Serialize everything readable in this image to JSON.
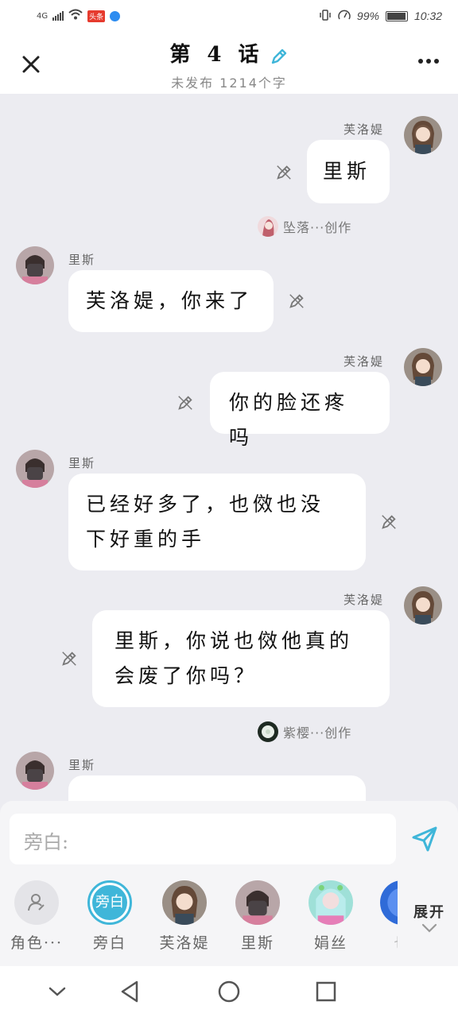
{
  "status_bar": {
    "network": "4G",
    "news_badge": "头条",
    "battery_text": "99%",
    "time": "10:32"
  },
  "header": {
    "title": "第 4 话",
    "subtitle": "未发布 1214个字"
  },
  "messages": [
    {
      "side": "right",
      "speaker": "芙洛媞",
      "text": "里斯"
    },
    {
      "type": "creator",
      "text": "坠落···创作"
    },
    {
      "side": "left",
      "speaker": "里斯",
      "text": "芙洛媞，你来了"
    },
    {
      "side": "right",
      "speaker": "芙洛媞",
      "text": "你的脸还疼吗"
    },
    {
      "side": "left",
      "speaker": "里斯",
      "lines": [
        "已经好多了，也傚也没",
        "下好重的手"
      ]
    },
    {
      "side": "right",
      "speaker": "芙洛媞",
      "lines": [
        "里斯，你说也傚他真的",
        "会废了你吗？"
      ]
    },
    {
      "type": "creator",
      "text": "紫樱···创作"
    },
    {
      "side": "left",
      "speaker": "里斯",
      "text": ""
    }
  ],
  "composer": {
    "placeholder": "旁白:",
    "roles": [
      {
        "label": "角色···",
        "icon": "person-outline-icon"
      },
      {
        "label": "旁白",
        "inner": "旁白"
      },
      {
        "label": "芙洛媞"
      },
      {
        "label": "里斯"
      },
      {
        "label": "娟丝"
      },
      {
        "label": "也"
      }
    ],
    "expand_label": "展开"
  },
  "colors": {
    "accent": "#3fb6d9",
    "background": "#ececf1"
  }
}
